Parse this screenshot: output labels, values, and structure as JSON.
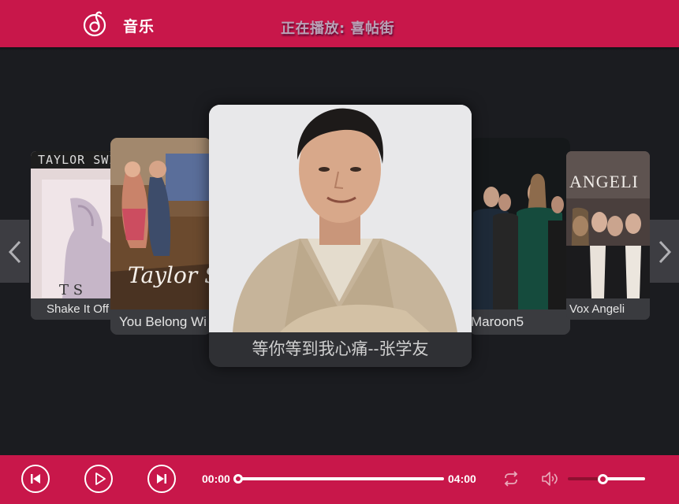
{
  "header": {
    "app_title": "音乐",
    "now_playing": "正在播放: 喜帖街",
    "logo_icon": "music-note-logo-icon"
  },
  "carousel": {
    "cards": [
      {
        "caption": "Shake It Off",
        "art_text": "TAYLOR SWI",
        "art_text_2": "T S"
      },
      {
        "caption": "You Belong Wi",
        "art_text": "Taylor S"
      },
      {
        "caption": "等你等到我心痛--张学友"
      },
      {
        "caption": "Maroon5"
      },
      {
        "caption": "Vox Angeli",
        "art_text": "ANGELI"
      }
    ],
    "prev_icon": "chevron-left-icon",
    "next_icon": "chevron-right-icon"
  },
  "player": {
    "current_time": "00:00",
    "total_time": "04:00",
    "progress": 0.0,
    "volume": 0.45,
    "icons": [
      "skip-previous-icon",
      "play-icon",
      "skip-next-icon",
      "repeat-icon",
      "volume-icon"
    ]
  },
  "colors": {
    "accent": "#c8174a",
    "background": "#1b1c20",
    "card": "#3a3b3f"
  }
}
